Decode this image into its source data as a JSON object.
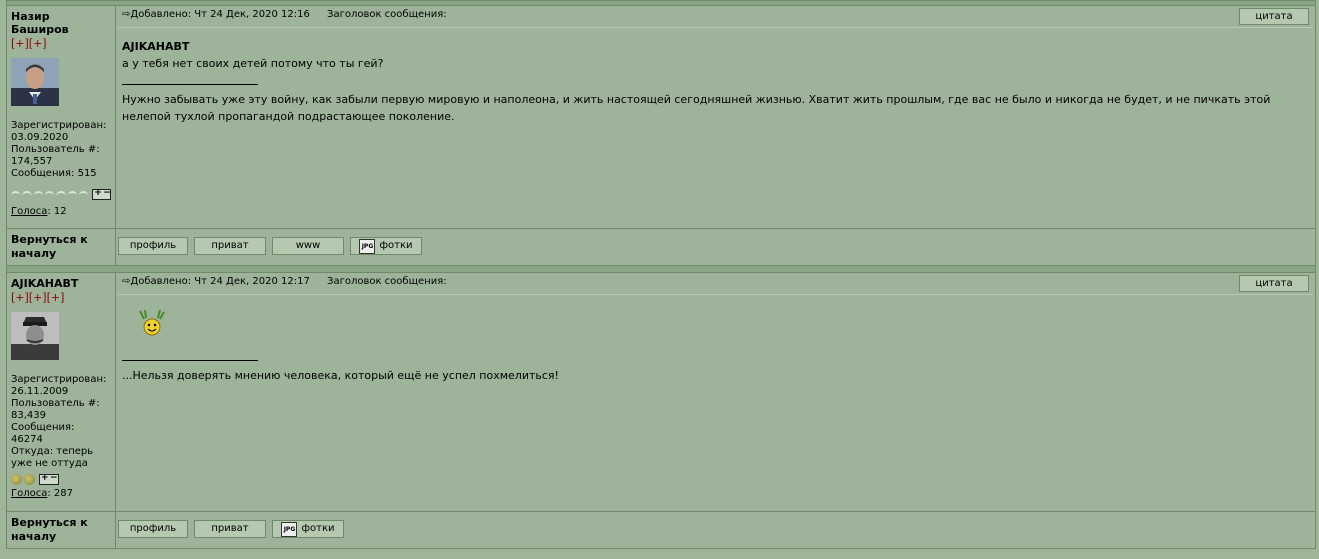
{
  "colors": {
    "background": "#9fb59a",
    "accent": "#8b0000",
    "border": "#6e8a69"
  },
  "posts": [
    {
      "author": "Назир Баширов",
      "plus": "[+][+]",
      "registered_label": "Зарегистрирован:",
      "registered": "03.09.2020",
      "user_label": "Пользователь #:",
      "user_id": "174,557",
      "messages_label": "Сообщения:",
      "messages": "515",
      "votes_label": "Голоса",
      "votes": ": 12",
      "posted": "Добавлено: Чт 24 Дек, 2020 12:16",
      "subject_label": "Заголовок сообщения:",
      "quote_btn": "цитата",
      "quote_author": "AJIKAHABT",
      "quote_text": "а у тебя нет своих детей потому что ты гей?",
      "signature": "Нужно забывать уже эту войну, как забыли первую мировую и наполеона, и жить настоящей сегодняшней жизнью. Хватит жить прошлым, где вас не было и никогда не будет, и не пичкать этой нелепой тухлой пропагандой подрастающее поколение.",
      "back_to_top": "Вернуться к началу",
      "buttons": {
        "profile": "профиль",
        "private": "приват",
        "www": "www",
        "photos": "фотки"
      }
    },
    {
      "author": "AJIKAHABT",
      "plus": "[+][+][+]",
      "registered_label": "Зарегистрирован:",
      "registered": "26.11.2009",
      "user_label": "Пользователь #:",
      "user_id": "83,439",
      "messages_label": "Сообщения:",
      "messages": "46274",
      "from_label": "Откуда: теперь",
      "from": "уже не оттуда",
      "votes_label": "Голоса",
      "votes": ": 287",
      "posted": "Добавлено: Чт 24 Дек, 2020 12:17",
      "subject_label": "Заголовок сообщения:",
      "quote_btn": "цитата",
      "signature": "...Нельзя доверять мнению человека, который ещё не успел похмелиться!",
      "back_to_top": "Вернуться к началу",
      "buttons": {
        "profile": "профиль",
        "private": "приват",
        "photos": "фотки"
      }
    }
  ],
  "icons": {
    "arrow": "post-arrow-icon",
    "jpg": "jpg-photo-icon",
    "smiley": "dancing-smiley-icon"
  }
}
